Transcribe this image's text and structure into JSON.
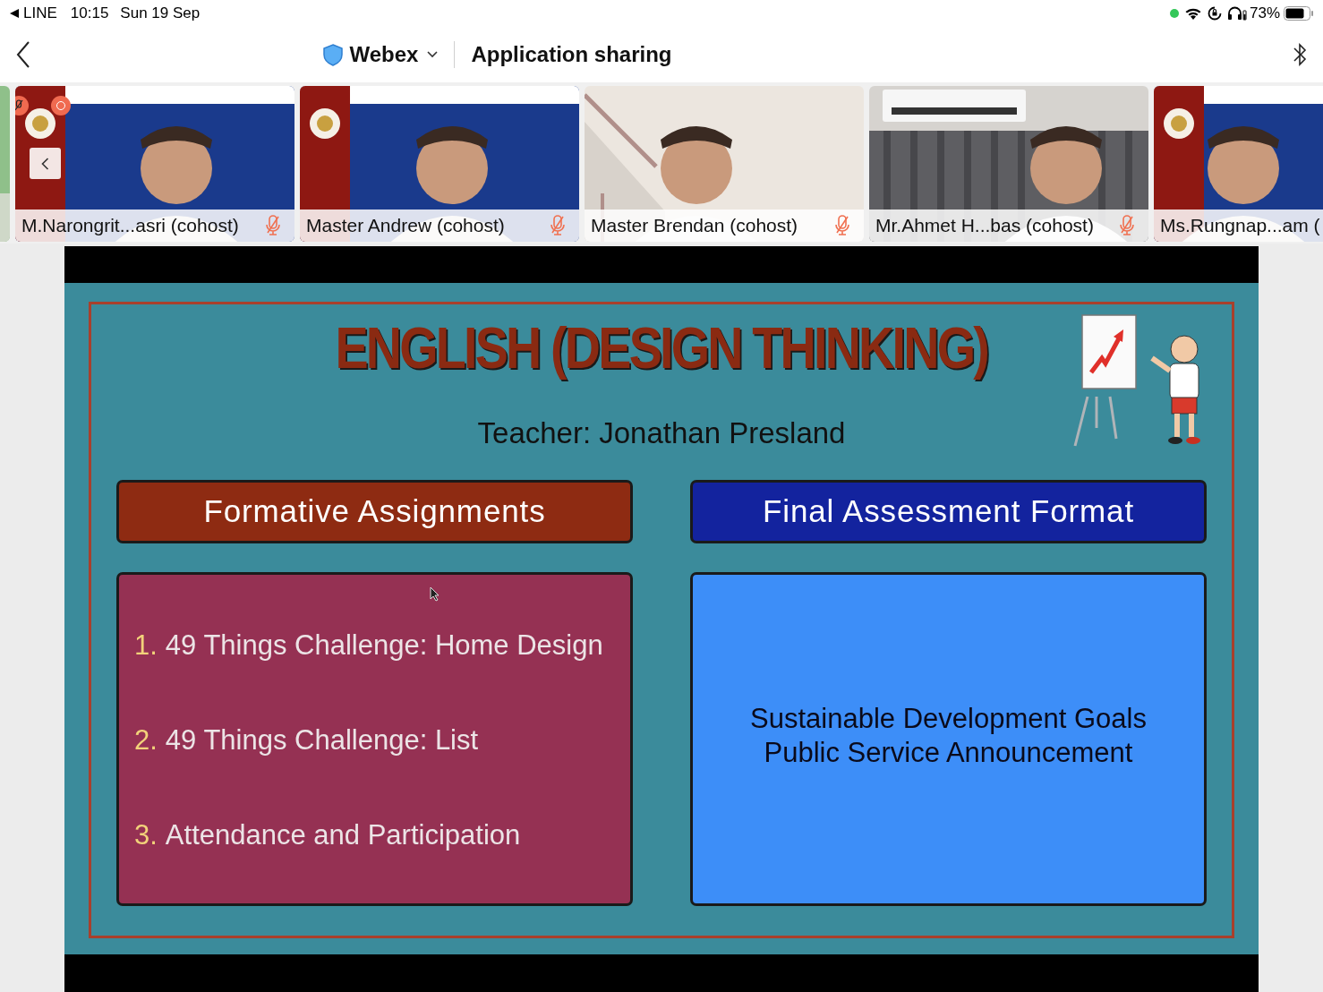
{
  "status_bar": {
    "back_app": "LINE",
    "time": "10:15",
    "date": "Sun 19 Sep",
    "battery": "73%"
  },
  "nav_bar": {
    "app": "Webex",
    "title": "Application sharing"
  },
  "participants": [
    {
      "name": "M.Narongrit...asri (cohost)",
      "muted": true
    },
    {
      "name": "Master Andrew (cohost)",
      "muted": true
    },
    {
      "name": "Master Brendan (cohost)",
      "muted": true
    },
    {
      "name": "Mr.Ahmet H...bas (cohost)",
      "muted": true
    },
    {
      "name": "Ms.Rungnap...am ("
    }
  ],
  "slide": {
    "title": "ENGLISH (DESIGN THINKING)",
    "teacher": "Teacher: Jonathan Presland",
    "sections": [
      {
        "heading": "Formative Assignments",
        "color": "#8e2b12",
        "kind": "list",
        "items": [
          {
            "number": "1.",
            "text": "49 Things Challenge: Home Design"
          },
          {
            "number": "2.",
            "text": "49 Things Challenge: List"
          },
          {
            "number": "3.",
            "text": "Attendance and Participation"
          }
        ]
      },
      {
        "heading": "Final Assessment Format",
        "color": "#13239e",
        "kind": "text",
        "lines": [
          "Sustainable Development Goals",
          "Public Service Announcement"
        ]
      }
    ]
  }
}
